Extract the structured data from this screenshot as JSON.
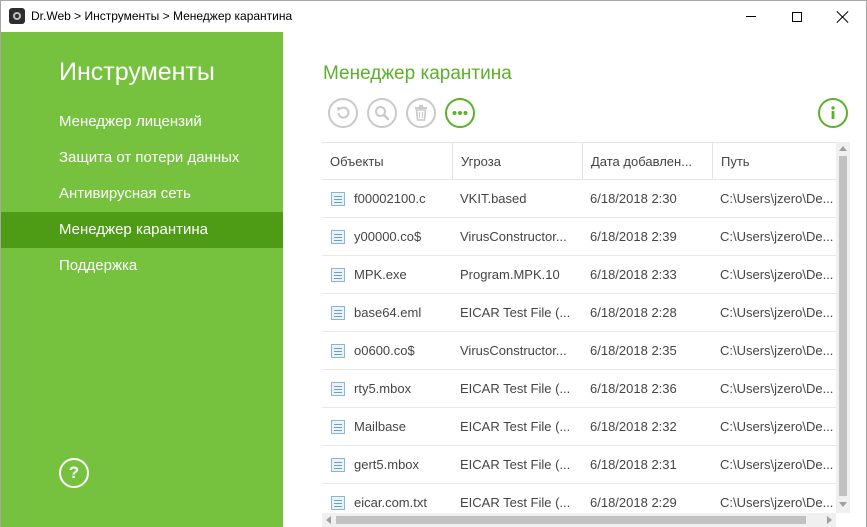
{
  "window": {
    "title": "Dr.Web > Инструменты > Менеджер карантина"
  },
  "sidebar": {
    "title": "Инструменты",
    "items": [
      {
        "label": "Менеджер лицензий"
      },
      {
        "label": "Защита от потери данных"
      },
      {
        "label": "Антивирусная сеть"
      },
      {
        "label": "Менеджер карантина"
      },
      {
        "label": "Поддержка"
      }
    ],
    "active_index": 3,
    "help_label": "?"
  },
  "main": {
    "title": "Менеджер карантина",
    "toolbar": [
      "restore-icon",
      "scan-icon",
      "delete-icon",
      "more-icon",
      "info-icon"
    ]
  },
  "table": {
    "columns": [
      "Объекты",
      "Угроза",
      "Дата добавлен...",
      "Путь"
    ],
    "rows": [
      {
        "object": "f00002100.c",
        "threat": "VKIT.based",
        "date": "6/18/2018 2:30",
        "path": "C:\\Users\\jzero\\De..."
      },
      {
        "object": "y00000.co$",
        "threat": "VirusConstructor...",
        "date": "6/18/2018 2:39",
        "path": "C:\\Users\\jzero\\De..."
      },
      {
        "object": "MPK.exe",
        "threat": "Program.MPK.10",
        "date": "6/18/2018 2:33",
        "path": "C:\\Users\\jzero\\De..."
      },
      {
        "object": "base64.eml",
        "threat": "EICAR Test File (...",
        "date": "6/18/2018 2:28",
        "path": "C:\\Users\\jzero\\De..."
      },
      {
        "object": "o0600.co$",
        "threat": "VirusConstructor...",
        "date": "6/18/2018 2:35",
        "path": "C:\\Users\\jzero\\De..."
      },
      {
        "object": "rty5.mbox",
        "threat": "EICAR Test File (...",
        "date": "6/18/2018 2:36",
        "path": "C:\\Users\\jzero\\De..."
      },
      {
        "object": "Mailbase",
        "threat": "EICAR Test File (...",
        "date": "6/18/2018 2:32",
        "path": "C:\\Users\\jzero\\De..."
      },
      {
        "object": "gert5.mbox",
        "threat": "EICAR Test File (...",
        "date": "6/18/2018 2:31",
        "path": "C:\\Users\\jzero\\De..."
      },
      {
        "object": "eicar.com.txt",
        "threat": "EICAR Test File (...",
        "date": "6/18/2018 2:29",
        "path": "C:\\Users\\jzero\\De..."
      }
    ]
  },
  "colors": {
    "sidebar": "#76c23f",
    "sidebar_active": "#4e9b16",
    "accent": "#5bb02c"
  }
}
